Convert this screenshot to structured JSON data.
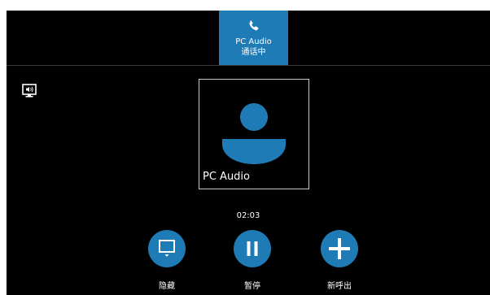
{
  "call_tab": {
    "name": "PC Audio",
    "status": "通话中",
    "icon": "phone-icon"
  },
  "speaker": {
    "icon": "speaker-monitor-icon"
  },
  "participant": {
    "name": "PC Audio",
    "icon": "avatar-icon"
  },
  "timer": "02:03",
  "controls": [
    {
      "label": "隐藏",
      "icon": "screen-hide-icon"
    },
    {
      "label": "暂停",
      "icon": "pause-icon"
    },
    {
      "label": "新呼出",
      "icon": "plus-icon"
    }
  ],
  "colors": {
    "accent": "#1f7bb5",
    "background": "#000000",
    "text": "#ffffff"
  }
}
